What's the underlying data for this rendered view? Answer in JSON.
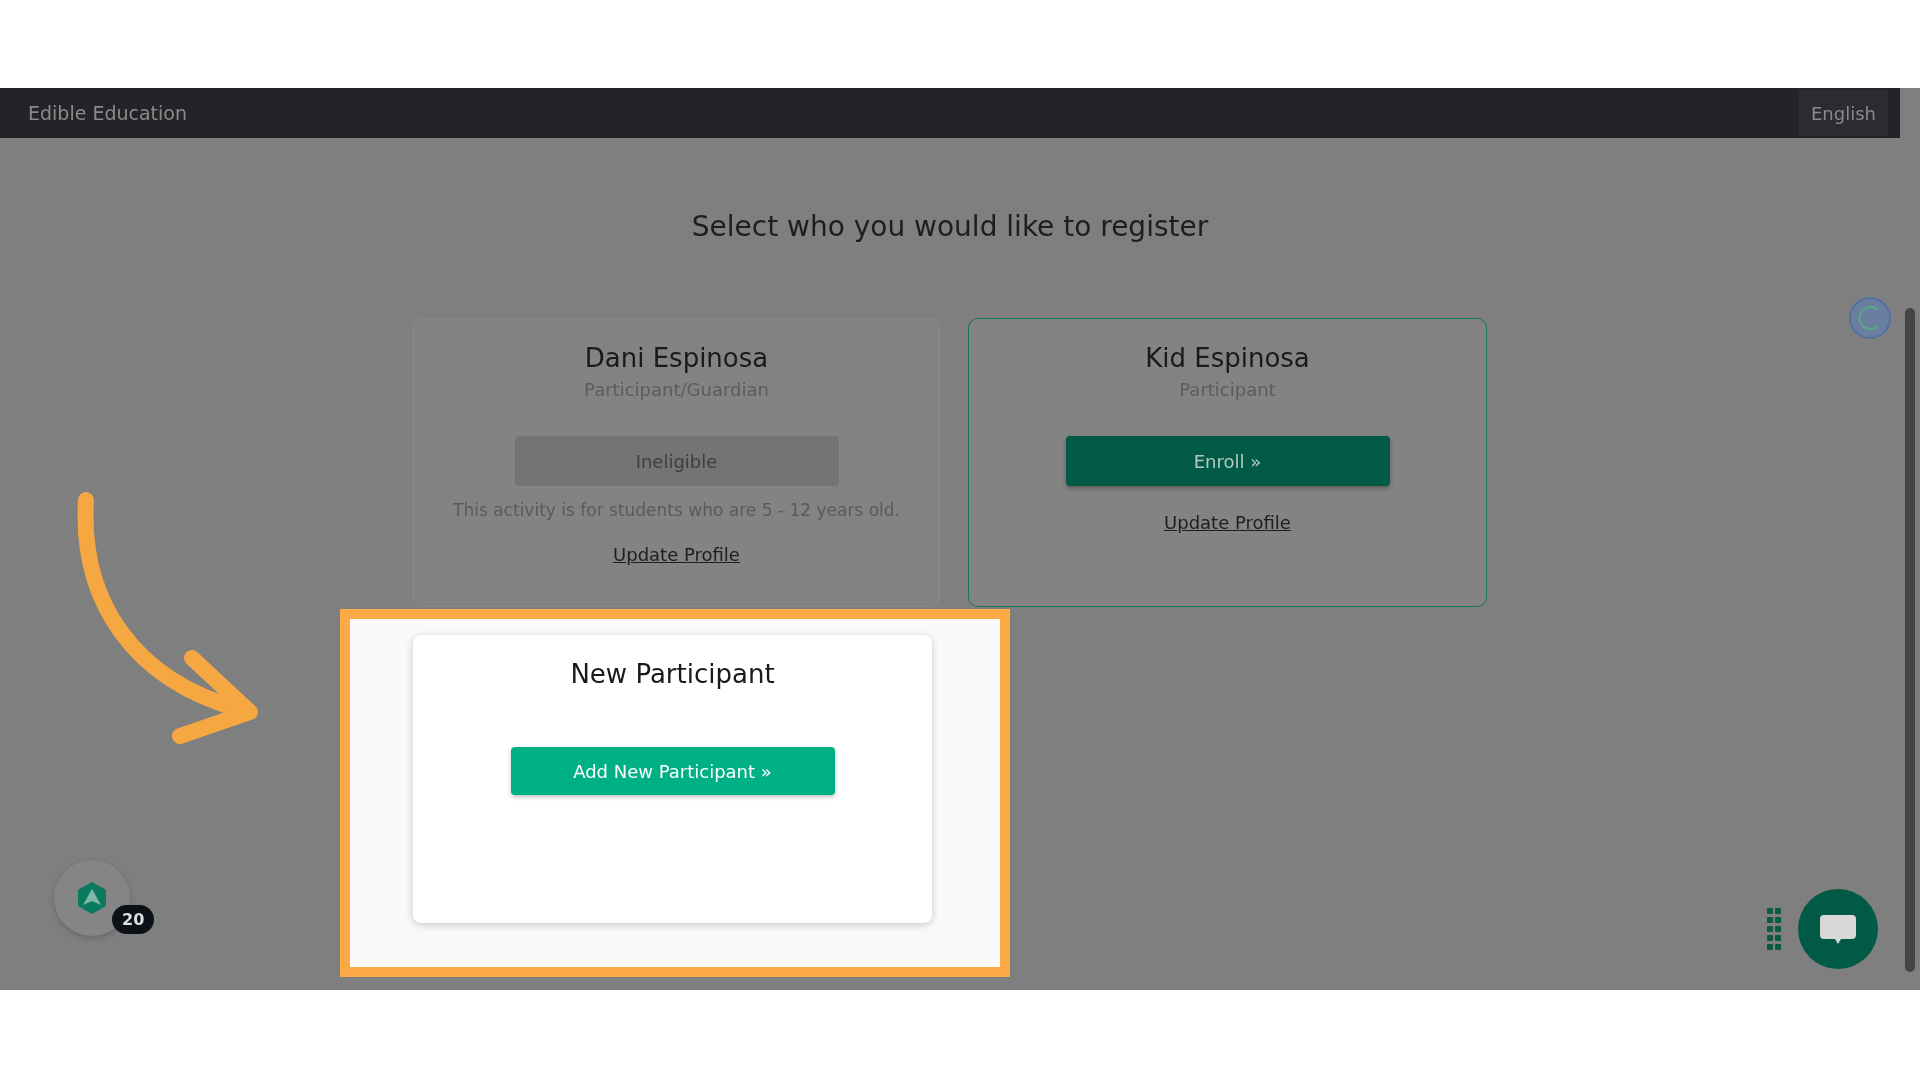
{
  "navbar": {
    "brand": "Edible Education",
    "language": "English"
  },
  "heading": "Select who you would like to register",
  "participants": [
    {
      "name": "Dani Espinosa",
      "role": "Participant/Guardian",
      "action": {
        "label": "Ineligible",
        "disabled": true
      },
      "note": "This activity is for students who are 5 - 12 years old.",
      "link": "Update Profile"
    },
    {
      "name": "Kid Espinosa",
      "role": "Participant",
      "action": {
        "label": "Enroll »",
        "disabled": false
      },
      "link": "Update Profile"
    }
  ],
  "new_participant": {
    "title": "New Participant",
    "button": "Add New Participant »"
  },
  "badge": "20"
}
